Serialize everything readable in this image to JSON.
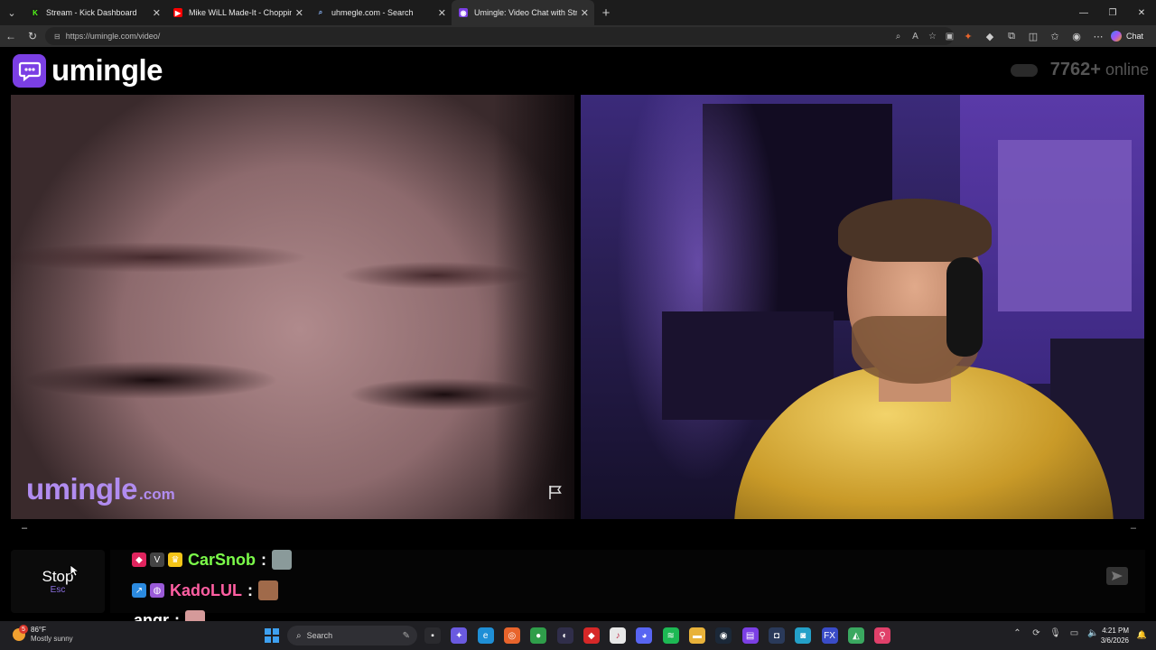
{
  "browser": {
    "tabs": [
      {
        "title": "Stream - Kick Dashboard",
        "favicon_color": "#1a1a1a",
        "favicon_glyph": "K",
        "glyph_color": "#53fc18",
        "active": false
      },
      {
        "title": "Mike WiLL Made-It - Choppin' Bla",
        "favicon_color": "#ff0000",
        "favicon_glyph": "▶",
        "glyph_color": "#ffffff",
        "active": false
      },
      {
        "title": "uhmegle.com - Search",
        "favicon_color": "#1c1c1c",
        "favicon_glyph": "⌕",
        "glyph_color": "#8ab4f8",
        "active": false
      },
      {
        "title": "Umingle: Video Chat with Stra",
        "favicon_color": "#7b3fe4",
        "favicon_glyph": "◉",
        "glyph_color": "#ffffff",
        "active": true
      }
    ],
    "url": "https://umingle.com/video/",
    "copilot_label": "Chat"
  },
  "site": {
    "logo_text": "umingle",
    "online_count": "7762+",
    "online_label": "online",
    "accent": "#7b3fe4"
  },
  "video_left": {
    "watermark_main": "umingle",
    "watermark_suffix": ".com"
  },
  "chat": {
    "stop_label": "Stop",
    "stop_key": "Esc",
    "messages": [
      {
        "username": "CarSnob",
        "color": "#7cfc4a",
        "badges": [
          {
            "icon": "gem-icon",
            "color": "#e0245e",
            "glyph": "◆"
          },
          {
            "icon": "shield-icon",
            "color": "#444",
            "glyph": "V"
          },
          {
            "icon": "crown-icon",
            "color": "#f5c518",
            "glyph": "♛"
          }
        ],
        "emote_color": "#8a9a9a"
      },
      {
        "username": "KadoLUL",
        "color": "#ff5fa2",
        "badges": [
          {
            "icon": "arrow-badge-icon",
            "color": "#2b8ae0",
            "glyph": "↗"
          },
          {
            "icon": "mask-icon",
            "color": "#9a5ad8",
            "glyph": "◍"
          }
        ],
        "emote_color": "#a06a4a"
      },
      {
        "username": "angr",
        "color": "#ffffff",
        "badges": [],
        "emote_color": "#d59a9a"
      }
    ]
  },
  "taskbar": {
    "weather_temp": "86°F",
    "weather_desc": "Mostly sunny",
    "weather_badge": "5",
    "search_placeholder": "Search",
    "apps": [
      {
        "icon": "file-explorer-icon",
        "color": "#2a2a2e",
        "glyph": "▪"
      },
      {
        "icon": "copilot-icon",
        "color": "#6a5ae0",
        "glyph": "✦"
      },
      {
        "icon": "edge-icon",
        "color": "#1f8fd6",
        "glyph": "e"
      },
      {
        "icon": "firefox-icon",
        "color": "#e8642c",
        "glyph": "◎"
      },
      {
        "icon": "chrome-icon",
        "color": "#2f9e4a",
        "glyph": "●"
      },
      {
        "icon": "obs-icon",
        "color": "#302e4a",
        "glyph": "◐"
      },
      {
        "icon": "video-app-icon",
        "color": "#d62828",
        "glyph": "◆"
      },
      {
        "icon": "music-icon",
        "color": "#e8e8e8",
        "glyph": "♪"
      },
      {
        "icon": "discord-icon",
        "color": "#5865f2",
        "glyph": "◕"
      },
      {
        "icon": "spotify-icon",
        "color": "#1db954",
        "glyph": "≋"
      },
      {
        "icon": "folder-icon",
        "color": "#e8b23a",
        "glyph": "▬"
      },
      {
        "icon": "steam-icon",
        "color": "#1b2838",
        "glyph": "◉"
      },
      {
        "icon": "editor-icon",
        "color": "#7b3fe4",
        "glyph": "▤"
      },
      {
        "icon": "app-dark-icon",
        "color": "#2a3a5a",
        "glyph": "◘"
      },
      {
        "icon": "app-blue-icon",
        "color": "#24a0c8",
        "glyph": "◙"
      },
      {
        "icon": "fx-icon",
        "color": "#3a4cc8",
        "glyph": "FX"
      },
      {
        "icon": "maps-icon",
        "color": "#3aa860",
        "glyph": "◭"
      },
      {
        "icon": "pin-icon",
        "color": "#e0406a",
        "glyph": "⚲"
      }
    ],
    "time": "4:21 PM",
    "date": "3/6/2026"
  }
}
